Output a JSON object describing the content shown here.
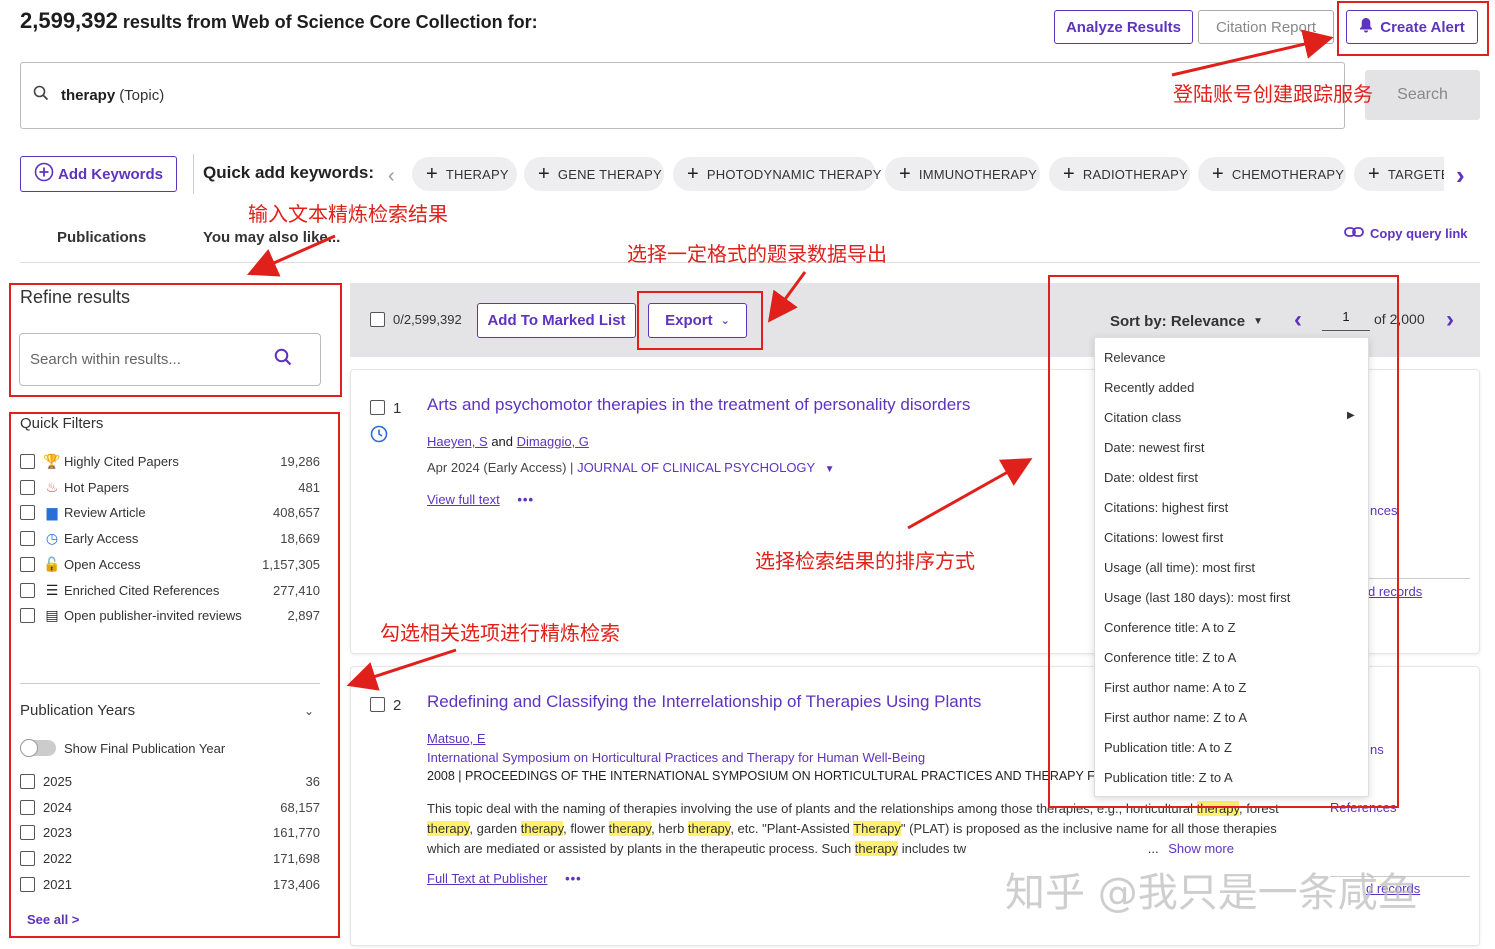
{
  "header": {
    "count": "2,599,392",
    "title_rest": "results from Web of Science Core Collection for:",
    "analyze": "Analyze Results",
    "citation_report": "Citation Report",
    "create_alert": "Create Alert"
  },
  "search": {
    "term": "therapy",
    "field": "(Topic)",
    "button": "Search"
  },
  "keywords": {
    "add": "Add Keywords",
    "label": "Quick add keywords:",
    "chips": [
      "THERAPY",
      "GENE THERAPY",
      "PHOTODYNAMIC THERAPY",
      "IMMUNOTHERAPY",
      "RADIOTHERAPY",
      "CHEMOTHERAPY",
      "TARGETE"
    ]
  },
  "tabs": {
    "publications": "Publications",
    "also_like": "You may also like...",
    "copy_link": "Copy query link"
  },
  "refine": {
    "title": "Refine results",
    "placeholder": "Search within results...",
    "quick_filters": "Quick Filters",
    "filters": [
      {
        "label": "Highly Cited Papers",
        "count": "19,286",
        "icon": "trophy-icon"
      },
      {
        "label": "Hot Papers",
        "count": "481",
        "icon": "flame-icon"
      },
      {
        "label": "Review Article",
        "count": "408,657",
        "icon": "document-icon"
      },
      {
        "label": "Early Access",
        "count": "18,669",
        "icon": "clock-icon"
      },
      {
        "label": "Open Access",
        "count": "1,157,305",
        "icon": "lock-open-icon"
      },
      {
        "label": "Enriched Cited References",
        "count": "277,410",
        "icon": "list-icon"
      },
      {
        "label": "Open publisher-invited reviews",
        "count": "2,897",
        "icon": "comment-icon"
      }
    ],
    "pub_years": "Publication Years",
    "show_final": "Show Final Publication Year",
    "years": [
      {
        "label": "2025",
        "count": "36"
      },
      {
        "label": "2024",
        "count": "68,157"
      },
      {
        "label": "2023",
        "count": "161,770"
      },
      {
        "label": "2022",
        "count": "171,698"
      },
      {
        "label": "2021",
        "count": "173,406"
      }
    ],
    "see_all": "See all >"
  },
  "toolbar": {
    "selected": "0/2,599,392",
    "add_marked": "Add To Marked List",
    "export": "Export",
    "sort": "Sort by: Relevance",
    "page": "1",
    "of_pages": "of 2,000"
  },
  "sort_options": [
    "Relevance",
    "Recently added",
    "Citation class",
    "Date: newest first",
    "Date: oldest first",
    "Citations: highest first",
    "Citations: lowest first",
    "Usage (all time): most first",
    "Usage (last 180 days): most first",
    "Conference title: A to Z",
    "Conference title: Z to A",
    "First author name: A to Z",
    "First author name: Z to A",
    "Publication title: A to Z",
    "Publication title: Z to A"
  ],
  "results": [
    {
      "num": "1",
      "title": "Arts and psychomotor therapies in the treatment of personality disorders",
      "author1": "Haeyen, S",
      "and": "and",
      "author2": "Dimaggio, G",
      "date": "Apr 2024 (Early Access) |",
      "journal": "JOURNAL OF CLINICAL PSYCHOLOGY",
      "full": "View full text",
      "side1": "nces",
      "side2": "d records"
    },
    {
      "num": "2",
      "title": "Redefining and Classifying the Interrelationship of Therapies Using Plants",
      "author1": "Matsuo, E",
      "conf": "International Symposium on Horticultural Practices and Therapy for Human Well-Being",
      "date": "2008 |",
      "journal": "PROCEEDINGS OF THE INTERNATIONAL SYMPOSIUM ON HORTICULTURAL PRACTICES AND THERAPY FOR HU",
      "abs1a": "This topic deal with the naming of therapies involving the use of plants and the relationships among those therapies, e.g., horticultural ",
      "hl": "therapy",
      "abs1b": ", forest",
      "abs2": "therapy",
      "abs2a": ", garden ",
      "abs2b": ", flower ",
      "abs2c": ", herb ",
      "abs2d": ", etc. \"Plant-Assisted ",
      "hl2": "Therapy",
      "abs2e": "\" (PLAT) is proposed as the inclusive name for all those therapies",
      "abs3": "which are mediated or assisted by plants in the therapeutic process. Such ",
      "abs3b": " includes tw",
      "ellipsis": "...",
      "show_more": "Show more",
      "full": "Full Text at Publisher",
      "side1": "ns",
      "side2": "References",
      "side3": "d records"
    }
  ],
  "annotations": {
    "alert": "登陆账号创建跟踪服务",
    "refine": "输入文本精炼检索结果",
    "export": "选择一定格式的题录数据导出",
    "sort": "选择检索结果的排序方式",
    "filters": "勾选相关选项进行精炼检索"
  },
  "watermark": "知乎 @我只是一条咸鱼"
}
